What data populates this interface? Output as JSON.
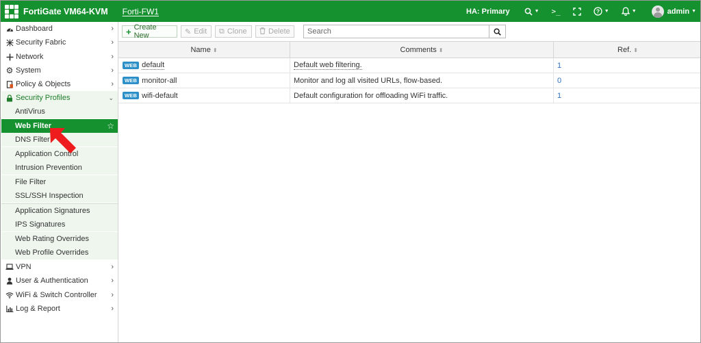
{
  "topbar": {
    "brand": "FortiGate VM64-KVM",
    "hostname": "Forti-FW1",
    "ha_status": "HA: Primary",
    "user": "admin",
    "cli_glyph": ">_",
    "accent_color": "#15912f"
  },
  "sidebar": {
    "items": [
      {
        "label": "Dashboard",
        "icon": "dashboard-icon"
      },
      {
        "label": "Security Fabric",
        "icon": "fabric-icon"
      },
      {
        "label": "Network",
        "icon": "network-icon"
      },
      {
        "label": "System",
        "icon": "gear-icon"
      },
      {
        "label": "Policy & Objects",
        "icon": "policy-icon"
      },
      {
        "label": "Security Profiles",
        "icon": "lock-icon"
      },
      {
        "label": "VPN",
        "icon": "laptop-icon"
      },
      {
        "label": "User & Authentication",
        "icon": "user-icon"
      },
      {
        "label": "WiFi & Switch Controller",
        "icon": "wifi-icon"
      },
      {
        "label": "Log & Report",
        "icon": "chart-icon"
      }
    ],
    "security_profiles": [
      "AntiVirus",
      "Web Filter",
      "DNS Filter",
      "Application Control",
      "Intrusion Prevention",
      "File Filter",
      "SSL/SSH Inspection",
      "Application Signatures",
      "IPS Signatures",
      "Web Rating Overrides",
      "Web Profile Overrides"
    ],
    "active_item": "Web Filter"
  },
  "toolbar": {
    "create_label": "Create New",
    "edit_label": "Edit",
    "clone_label": "Clone",
    "delete_label": "Delete",
    "search_placeholder": "Search"
  },
  "table": {
    "columns": [
      "Name",
      "Comments",
      "Ref."
    ],
    "rows": [
      {
        "badge": "WEB",
        "name": "default",
        "comment": "Default web filtering.",
        "ref": "1"
      },
      {
        "badge": "WEB",
        "name": "monitor-all",
        "comment": "Monitor and log all visited URLs, flow-based.",
        "ref": "0"
      },
      {
        "badge": "WEB",
        "name": "wifi-default",
        "comment": "Default configuration for offloading WiFi traffic.",
        "ref": "1"
      }
    ]
  }
}
